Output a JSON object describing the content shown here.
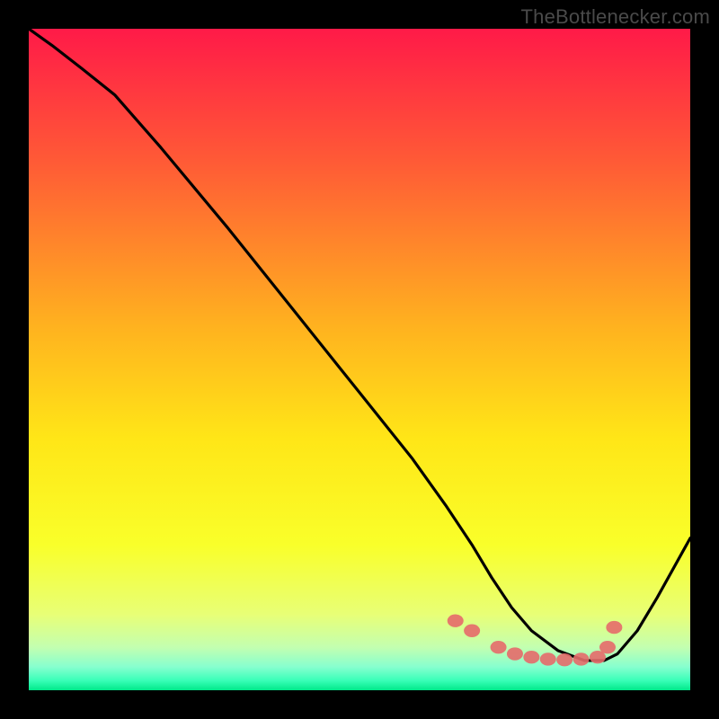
{
  "attribution": "TheBottlenecker.com",
  "chart_data": {
    "type": "line",
    "title": "",
    "xlabel": "",
    "ylabel": "",
    "xlim": [
      0,
      100
    ],
    "ylim": [
      0,
      100
    ],
    "grid": false,
    "legend": false,
    "background_gradient": {
      "stops": [
        {
          "offset": 0.0,
          "color": "#ff1a48"
        },
        {
          "offset": 0.2,
          "color": "#ff5a36"
        },
        {
          "offset": 0.45,
          "color": "#ffb21f"
        },
        {
          "offset": 0.62,
          "color": "#ffe617"
        },
        {
          "offset": 0.78,
          "color": "#f9ff2a"
        },
        {
          "offset": 0.885,
          "color": "#e8ff76"
        },
        {
          "offset": 0.935,
          "color": "#c3ffb0"
        },
        {
          "offset": 0.965,
          "color": "#86ffcf"
        },
        {
          "offset": 0.985,
          "color": "#3affb8"
        },
        {
          "offset": 1.0,
          "color": "#00e88a"
        }
      ]
    },
    "series": [
      {
        "name": "bottleneck-curve",
        "x": [
          0.0,
          3.5,
          8.0,
          13.0,
          20.0,
          30.0,
          40.0,
          50.0,
          58.0,
          63.0,
          67.0,
          70.0,
          73.0,
          76.0,
          80.0,
          84.0,
          87.0,
          89.0,
          92.0,
          95.0,
          100.0
        ],
        "y": [
          100.0,
          97.5,
          94.0,
          90.0,
          82.0,
          70.0,
          57.5,
          45.0,
          35.0,
          28.0,
          22.0,
          17.0,
          12.5,
          9.0,
          6.0,
          4.5,
          4.5,
          5.5,
          9.0,
          14.0,
          23.0
        ]
      }
    ],
    "markers": {
      "name": "optimal-range-dots",
      "x": [
        64.5,
        67.0,
        71.0,
        73.5,
        76.0,
        78.5,
        81.0,
        83.5,
        86.0,
        87.5,
        88.5
      ],
      "y": [
        10.5,
        9.0,
        6.5,
        5.5,
        5.0,
        4.7,
        4.6,
        4.7,
        5.0,
        6.5,
        9.5
      ]
    }
  }
}
